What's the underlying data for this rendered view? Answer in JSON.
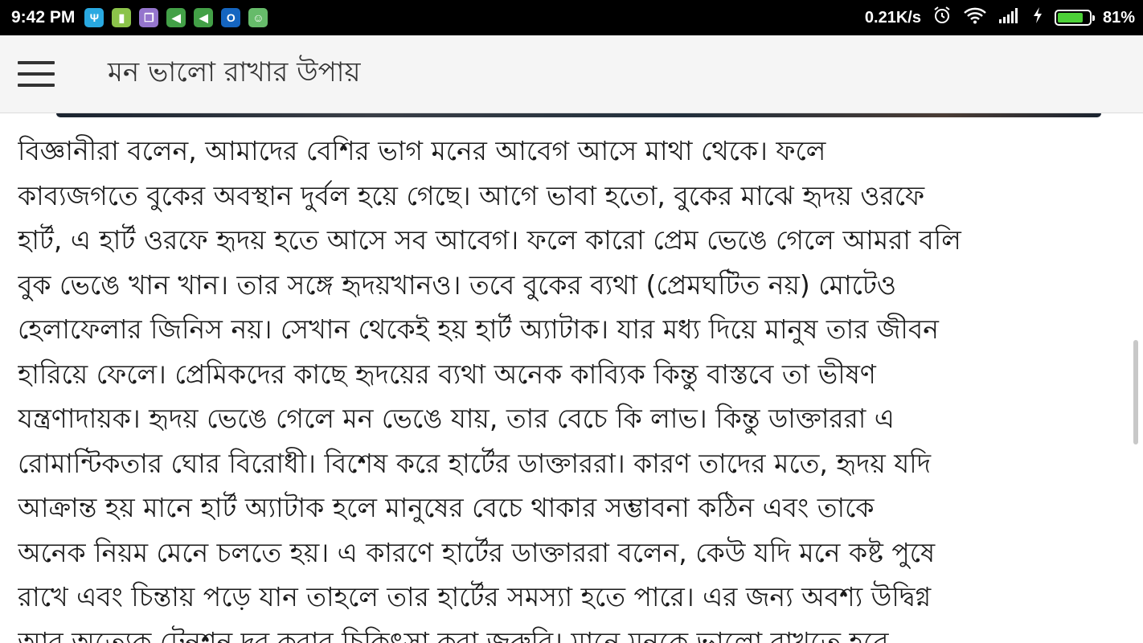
{
  "status_bar": {
    "time": "9:42 PM",
    "notification_icons": [
      {
        "name": "usb-icon",
        "color": "#29a9e1",
        "glyph": "Ψ"
      },
      {
        "name": "battery-app-icon",
        "color": "#8bc34a",
        "glyph": "▮"
      },
      {
        "name": "files-app-icon",
        "color": "#9575cd",
        "glyph": "❐"
      },
      {
        "name": "share-app-icon",
        "color": "#43a047",
        "glyph": "◀"
      },
      {
        "name": "share-app-2-icon",
        "color": "#43a047",
        "glyph": "◀"
      },
      {
        "name": "outlook-icon",
        "color": "#1565c0",
        "glyph": "O"
      },
      {
        "name": "android-app-icon",
        "color": "#66bb6a",
        "glyph": "☺"
      }
    ],
    "network_speed": "0.21K/s",
    "battery_percent": "81%",
    "battery_level": 0.81
  },
  "app_bar": {
    "title": "মন ভালো রাখার উপায়"
  },
  "article": {
    "lines": [
      "বিজ্ঞানীরা বলেন, আমাদের বেশির ভাগ মনের আবেগ আসে মাথা থেকে। ফলে",
      "কাব্যজগতে বুকের অবস্থান দুর্বল হয়ে গেছে। আগে ভাবা হতো, বুকের মাঝে হৃদয় ওরফে",
      "হার্ট, এ হার্ট ওরফে হৃদয় হতে আসে সব আবেগ। ফলে কারো প্রেম ভেঙে গেলে আমরা বলি",
      "বুক ভেঙে খান খান। তার সঙ্গে হৃদয়খানও। তবে বুকের ব্যথা (প্রেমঘটিত নয়) মোটেও",
      "হেলাফেলার জিনিস নয়। সেখান থেকেই হয় হার্ট অ্যাটাক। যার মধ্য দিয়ে মানুষ তার জীবন",
      "হারিয়ে ফেলে। প্রেমিকদের কাছে হৃদয়ের ব্যথা অনেক কাব্যিক কিন্তু বাস্তবে তা ভীষণ",
      "যন্ত্রণাদায়ক। হৃদয় ভেঙে গেলে মন ভেঙে যায়, তার বেচে কি লাভ। কিন্তু ডাক্তাররা এ",
      "রোমান্টিকতার ঘোর বিরোধী। বিশেষ করে হার্টের ডাক্তাররা। কারণ তাদের মতে, হৃদয় যদি",
      "আক্রান্ত হয় মানে হার্ট অ্যাটাক হলে মানুষের বেচে থাকার সম্ভাবনা কঠিন এবং তাকে",
      "অনেক নিয়ম মেনে চলতে হয়। এ কারণে হার্টের ডাক্তাররা বলেন, কেউ যদি মনে কষ্ট পুষে",
      "রাখে এবং চিন্তায় পড়ে যান তাহলে তার হার্টের সমস্যা হতে পারে। এর জন্য অবশ্য উদ্বিগ্ন",
      "আর অত্যেক টেনশন দূর করার চিকিৎসা করা জরুরি। মানে মনকে ভালো রাখতে হবে"
    ]
  }
}
